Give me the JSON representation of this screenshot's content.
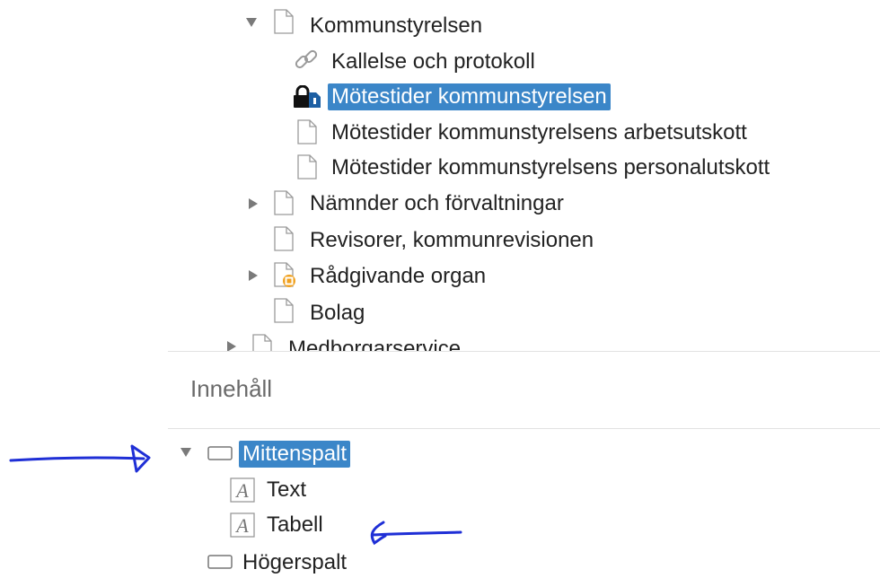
{
  "page_tree": {
    "items": [
      {
        "label": "Kommunstyrelsen"
      },
      {
        "label": "Kallelse och protokoll"
      },
      {
        "label": "Mötestider kommunstyrelsen"
      },
      {
        "label": "Mötestider kommunstyrelsens arbetsutskott"
      },
      {
        "label": "Mötestider kommunstyrelsens personalutskott"
      },
      {
        "label": "Nämnder och förvaltningar"
      },
      {
        "label": "Revisorer, kommunrevisionen"
      },
      {
        "label": "Rådgivande organ"
      },
      {
        "label": "Bolag"
      },
      {
        "label": "Medborgarservice"
      }
    ]
  },
  "content_panel": {
    "title": "Innehåll",
    "items": [
      {
        "label": "Mittenspalt"
      },
      {
        "label": "Text"
      },
      {
        "label": "Tabell"
      },
      {
        "label": "Högerspalt"
      }
    ]
  },
  "colors": {
    "selection": "#3b86c8",
    "annotation_ink": "#1f2fd6"
  },
  "icons": [
    "triangle-down",
    "triangle-right",
    "page",
    "link",
    "lock-page",
    "shortcut-page",
    "block",
    "text-block"
  ]
}
